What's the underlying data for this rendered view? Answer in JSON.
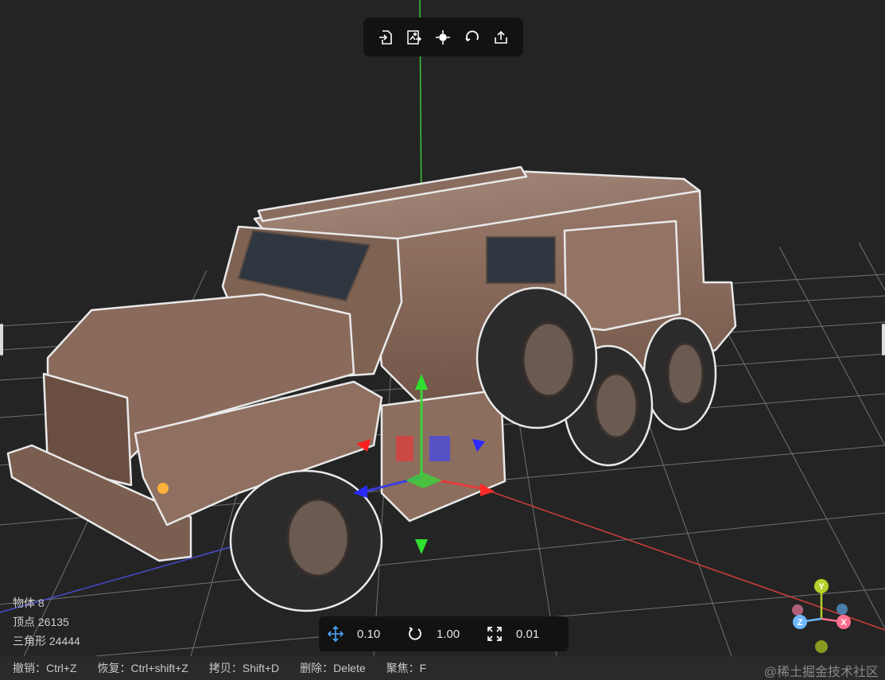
{
  "toolbar": {
    "buttons": [
      {
        "name": "import-button",
        "icon": "file-import-icon"
      },
      {
        "name": "import-scene-button",
        "icon": "image-swap-icon"
      },
      {
        "name": "focus-button",
        "icon": "crosshair-icon"
      },
      {
        "name": "reset-button",
        "icon": "rotate-reset-icon"
      },
      {
        "name": "export-button",
        "icon": "share-upload-icon"
      }
    ]
  },
  "stats": {
    "objects": "物体 8",
    "vertices": "顶点 26135",
    "triangles": "三角形 24444"
  },
  "transform": {
    "translate_icon": "move-arrows-icon",
    "translate_value": "0.10",
    "rotate_icon": "rotate-icon",
    "rotate_value": "1.00",
    "scale_icon": "scale-expand-icon",
    "scale_value": "0.01"
  },
  "statusbar": {
    "undo": "撤销：Ctrl+Z",
    "redo": "恢复：Ctrl+shift+Z",
    "copy": "拷贝：Shift+D",
    "delete": "删除：Delete",
    "focus": "聚焦：F",
    "watermark": "@稀土掘金技术社区"
  },
  "axis_gizmo": {
    "y_label": "Y",
    "x_label": "X",
    "z_label": "Z",
    "y_color": "#b5d12a",
    "x_color": "#ff6f8f",
    "z_color": "#6fb8ff"
  },
  "colors": {
    "background": "#242424",
    "grid": "#8c8c8c",
    "axis_x": "#d23c3c",
    "axis_y": "#3cc83c",
    "axis_z": "#3c3cd2",
    "vehicle_body": "#8c6c5c"
  }
}
